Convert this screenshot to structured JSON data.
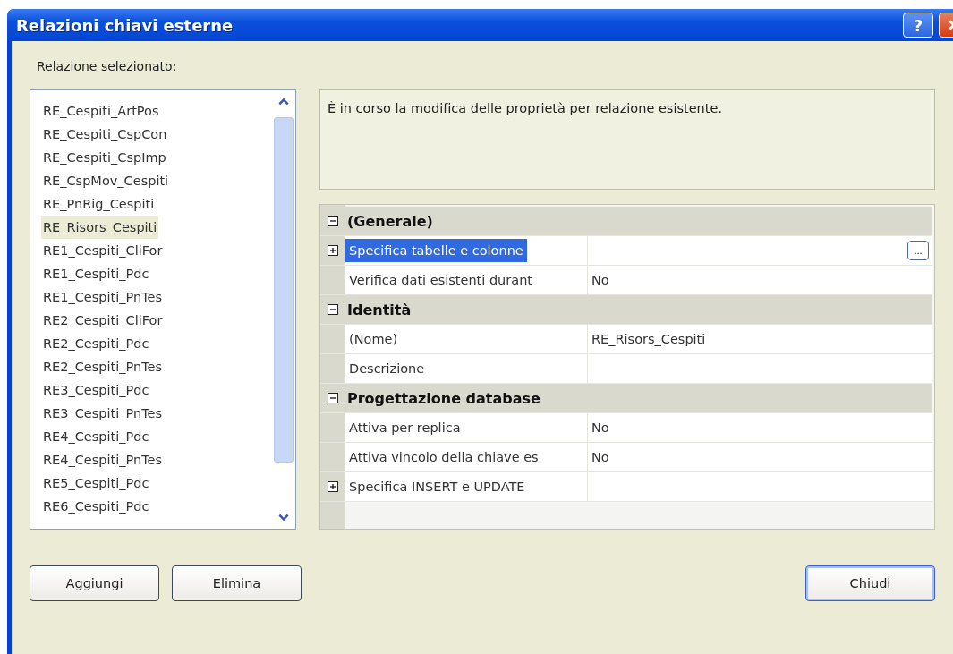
{
  "window": {
    "title": "Relazioni chiavi esterne",
    "help_button": "?"
  },
  "list_label": "Relazione selezionato:",
  "relations": [
    {
      "name": "RE_Cespiti_ArtPos",
      "selected": false
    },
    {
      "name": "RE_Cespiti_CspCon",
      "selected": false
    },
    {
      "name": "RE_Cespiti_CspImp",
      "selected": false
    },
    {
      "name": "RE_CspMov_Cespiti",
      "selected": false
    },
    {
      "name": "RE_PnRig_Cespiti",
      "selected": false
    },
    {
      "name": "RE_Risors_Cespiti",
      "selected": true
    },
    {
      "name": "RE1_Cespiti_CliFor",
      "selected": false
    },
    {
      "name": "RE1_Cespiti_Pdc",
      "selected": false
    },
    {
      "name": "RE1_Cespiti_PnTes",
      "selected": false
    },
    {
      "name": "RE2_Cespiti_CliFor",
      "selected": false
    },
    {
      "name": "RE2_Cespiti_Pdc",
      "selected": false
    },
    {
      "name": "RE2_Cespiti_PnTes",
      "selected": false
    },
    {
      "name": "RE3_Cespiti_Pdc",
      "selected": false
    },
    {
      "name": "RE3_Cespiti_PnTes",
      "selected": false
    },
    {
      "name": "RE4_Cespiti_Pdc",
      "selected": false
    },
    {
      "name": "RE4_Cespiti_PnTes",
      "selected": false
    },
    {
      "name": "RE5_Cespiti_Pdc",
      "selected": false
    },
    {
      "name": "RE6_Cespiti_Pdc",
      "selected": false
    }
  ],
  "description": "È in corso la modifica delle proprietà per relazione esistente.",
  "property_grid": [
    {
      "kind": "section",
      "name": "(Generale)",
      "expanded": true
    },
    {
      "kind": "property",
      "name": "Specifica tabelle e colonne",
      "expandable": true,
      "selected": true,
      "button": "..."
    },
    {
      "kind": "property",
      "name": "Verifica dati esistenti durant",
      "value": "No",
      "selected": false
    },
    {
      "kind": "section",
      "name": "Identità",
      "expanded": true
    },
    {
      "kind": "property",
      "name": "(Nome)",
      "value": "RE_Risors_Cespiti",
      "selected": false
    },
    {
      "kind": "property",
      "name": "Descrizione",
      "selected": false
    },
    {
      "kind": "section",
      "name": "Progettazione database",
      "expanded": true
    },
    {
      "kind": "property",
      "name": "Attiva per replica",
      "value": "No",
      "selected": false
    },
    {
      "kind": "property",
      "name": "Attiva vincolo della chiave es",
      "value": "No",
      "selected": false
    },
    {
      "kind": "property",
      "name": "Specifica INSERT e UPDATE",
      "expandable": true,
      "selected": false
    }
  ],
  "buttons_left": [
    "Aggiungi",
    "Elimina"
  ],
  "buttons_right": [
    "Chiudi"
  ]
}
